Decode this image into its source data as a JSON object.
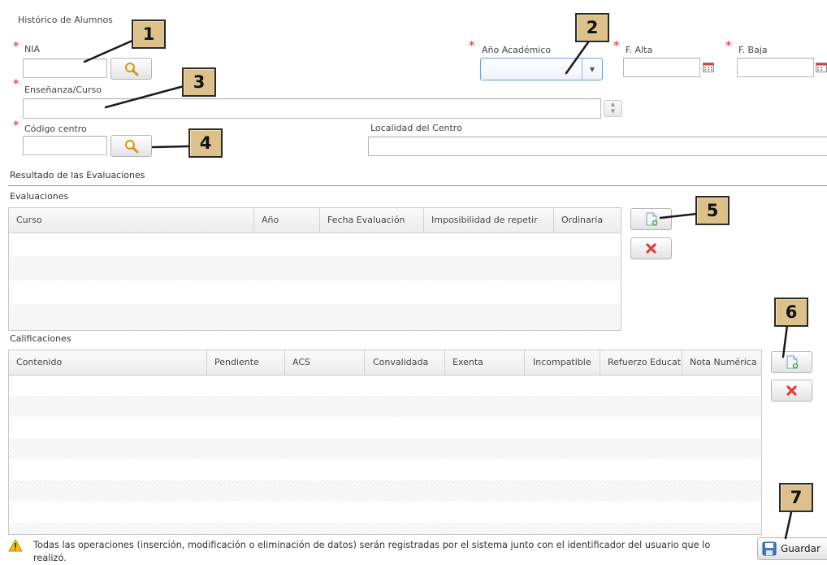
{
  "form": {
    "title": "Histórico de Alumnos",
    "nia_label": "NIA",
    "anio_label": "Año Académico",
    "f_alta_label": "F. Alta",
    "f_baja_label": "F. Baja",
    "ensenanza_label": "Enseñanza/Curso",
    "codigo_label": "Código centro",
    "localidad_label": "Localidad del Centro",
    "required_mark": "*"
  },
  "resultados": {
    "title": "Resultado de las Evaluaciones"
  },
  "evaluaciones": {
    "title": "Evaluaciones",
    "columns": [
      "Curso",
      "Año",
      "Fecha Evaluación",
      "Imposibilidad de repetir",
      "Ordinaria"
    ]
  },
  "calificaciones": {
    "title": "Calificaciones",
    "columns": [
      "Contenido",
      "Pendiente",
      "ACS",
      "Convalidada",
      "Exenta",
      "Incompatible",
      "Refuerzo Educativo",
      "Nota Numérica"
    ]
  },
  "footer": {
    "notice": "Todas las operaciones (inserción, modificación o eliminación de datos) serán registradas por el sistema junto con el identificador del usuario que lo realizó.",
    "save_label": "Guardar"
  },
  "callouts": [
    "1",
    "2",
    "3",
    "4",
    "5",
    "6",
    "7"
  ],
  "icons": {
    "search": "magnifier-icon",
    "calendar": "calendar-icon",
    "add": "new-document-icon",
    "delete": "red-x-icon",
    "warning": "warning-triangle-icon",
    "save": "floppy-disk-icon"
  },
  "colors": {
    "required": "#d9272e",
    "section_rule": "#4a9fd8",
    "callout_fill": "#dcc18a",
    "focus_border": "#6f9fd8"
  }
}
